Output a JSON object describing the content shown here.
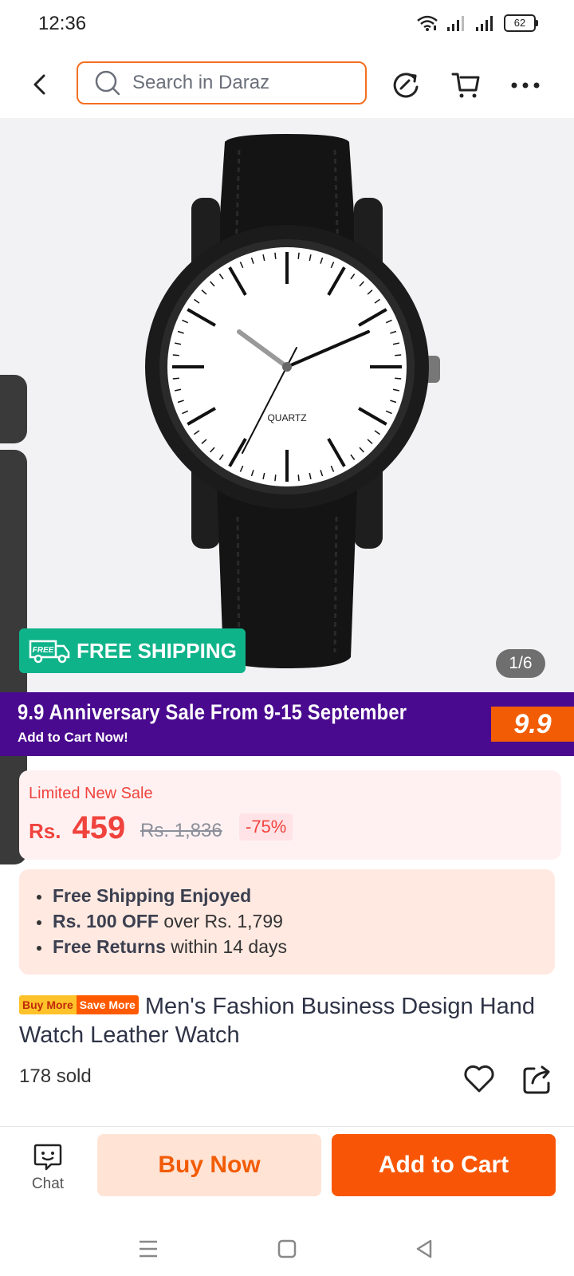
{
  "status_bar": {
    "time": "12:36",
    "battery": "62"
  },
  "header": {
    "search_placeholder": "Search in Daraz",
    "icons": [
      "back-arrow-icon",
      "search-icon",
      "refresh-share-icon",
      "cart-icon",
      "more-icon"
    ]
  },
  "gallery": {
    "counter": "1/6",
    "free_shipping_badge": "FREE SHIPPING",
    "free_shipping_icon_text": "FREE",
    "watch_dial_text": "QUARTZ"
  },
  "sale_banner": {
    "title": "9.9 Anniversary Sale From 9-15 September",
    "subtitle": "Add to Cart Now!",
    "badge": "9.9",
    "color": "#4a0a8f"
  },
  "price": {
    "label": "Limited New Sale",
    "currency": "Rs.",
    "current": "459",
    "original": "Rs. 1,836",
    "discount": "-75%"
  },
  "benefits": [
    {
      "bold": "Free Shipping Enjoyed",
      "rest": ""
    },
    {
      "bold": "Rs. 100 OFF",
      "rest": " over Rs. 1,799"
    },
    {
      "bold": "Free Returns",
      "rest": " within 14 days"
    }
  ],
  "product": {
    "promo_tag_1": "Buy More",
    "promo_tag_2": "Save More",
    "title": "Men's Fashion Business Design Hand Watch Leather Watch",
    "sold": "178 sold"
  },
  "bottom_bar": {
    "chat_label": "Chat",
    "buy_now": "Buy Now",
    "add_to_cart": "Add to Cart"
  },
  "colors": {
    "accent": "#f85606",
    "price": "#f0433d",
    "free_shipping": "#0fb38a"
  }
}
